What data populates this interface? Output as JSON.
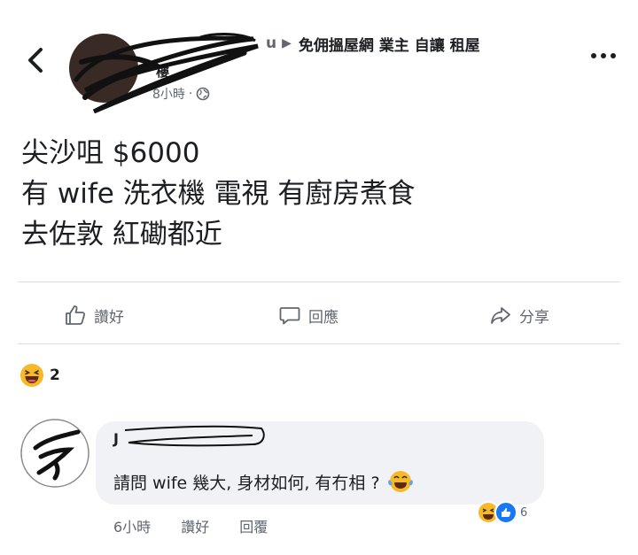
{
  "header": {
    "back_icon": "chevron-left-icon",
    "crumb_arrow": "▶",
    "name_fragment": "u",
    "group_name": "免佣搵屋網 業主 自讓 租屋",
    "subname_fragment": "樓",
    "time": "8小時",
    "dot": "·",
    "privacy_icon": "globe-icon",
    "more_icon": "more-horizontal-icon"
  },
  "post": {
    "lines": [
      "尖沙咀 $6000",
      "有 wife 洗衣機 電視 有廚房煮食",
      "去佐敦 紅磡都近"
    ]
  },
  "actions": {
    "like": "讚好",
    "comment": "回應",
    "share": "分享"
  },
  "reactions": {
    "icon": "haha-emoji-icon",
    "count": "2"
  },
  "comment": {
    "author_initial": "J",
    "text": "請問 wife 幾大, 身材如何, 有冇相 ?",
    "time": "6小時",
    "like": "讚好",
    "reply": "回覆",
    "reaction_count": "6"
  },
  "colors": {
    "accent": "#1877f2",
    "haha": "#f7b928",
    "text_secondary": "#606770",
    "bubble": "#f0f2f5"
  }
}
